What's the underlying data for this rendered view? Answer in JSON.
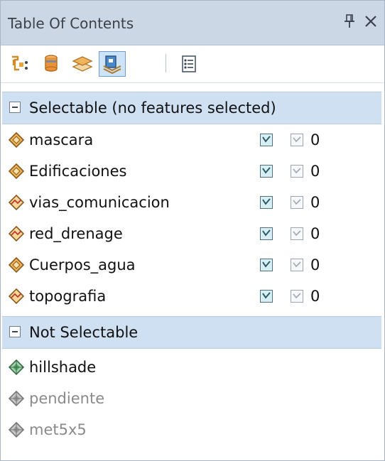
{
  "window": {
    "title": "Table Of Contents",
    "pin_icon": "pin-icon",
    "close_icon": "close-icon"
  },
  "toolbar": {
    "buttons": [
      {
        "name": "list-by-drawing-order",
        "icon": "list-by-drawing-order-icon"
      },
      {
        "name": "list-by-source",
        "icon": "list-by-source-icon"
      },
      {
        "name": "list-by-visibility",
        "icon": "list-by-visibility-icon"
      },
      {
        "name": "list-by-selection",
        "icon": "list-by-selection-icon",
        "active": true
      },
      {
        "name": "options",
        "icon": "options-icon"
      }
    ]
  },
  "groups": [
    {
      "label": "Selectable (no features selected)",
      "layers": [
        {
          "name": "mascara",
          "icon": "polygon-layer-icon",
          "count": "0"
        },
        {
          "name": "Edificaciones",
          "icon": "polygon-layer-icon",
          "count": "0"
        },
        {
          "name": "vias_comunicacion",
          "icon": "line-layer-icon",
          "count": "0"
        },
        {
          "name": "red_drenage",
          "icon": "line-layer-icon",
          "count": "0"
        },
        {
          "name": "Cuerpos_agua",
          "icon": "polygon-layer-icon",
          "count": "0"
        },
        {
          "name": "topografia",
          "icon": "line-layer-icon",
          "count": "0"
        }
      ]
    },
    {
      "label": "Not Selectable",
      "layers": [
        {
          "name": "hillshade",
          "icon": "raster-layer-icon"
        },
        {
          "name": "pendiente",
          "icon": "raster-layer-icon",
          "disabled": true
        },
        {
          "name": "met5x5",
          "icon": "raster-layer-icon",
          "disabled": true
        }
      ]
    }
  ],
  "colors": {
    "titlebar": "#ccd7e6",
    "group_header": "#cfe0f3",
    "polygon_icon": "#e8a33c",
    "raster_icon": "#7fbf8e",
    "disabled_text": "#8a8a8a"
  }
}
